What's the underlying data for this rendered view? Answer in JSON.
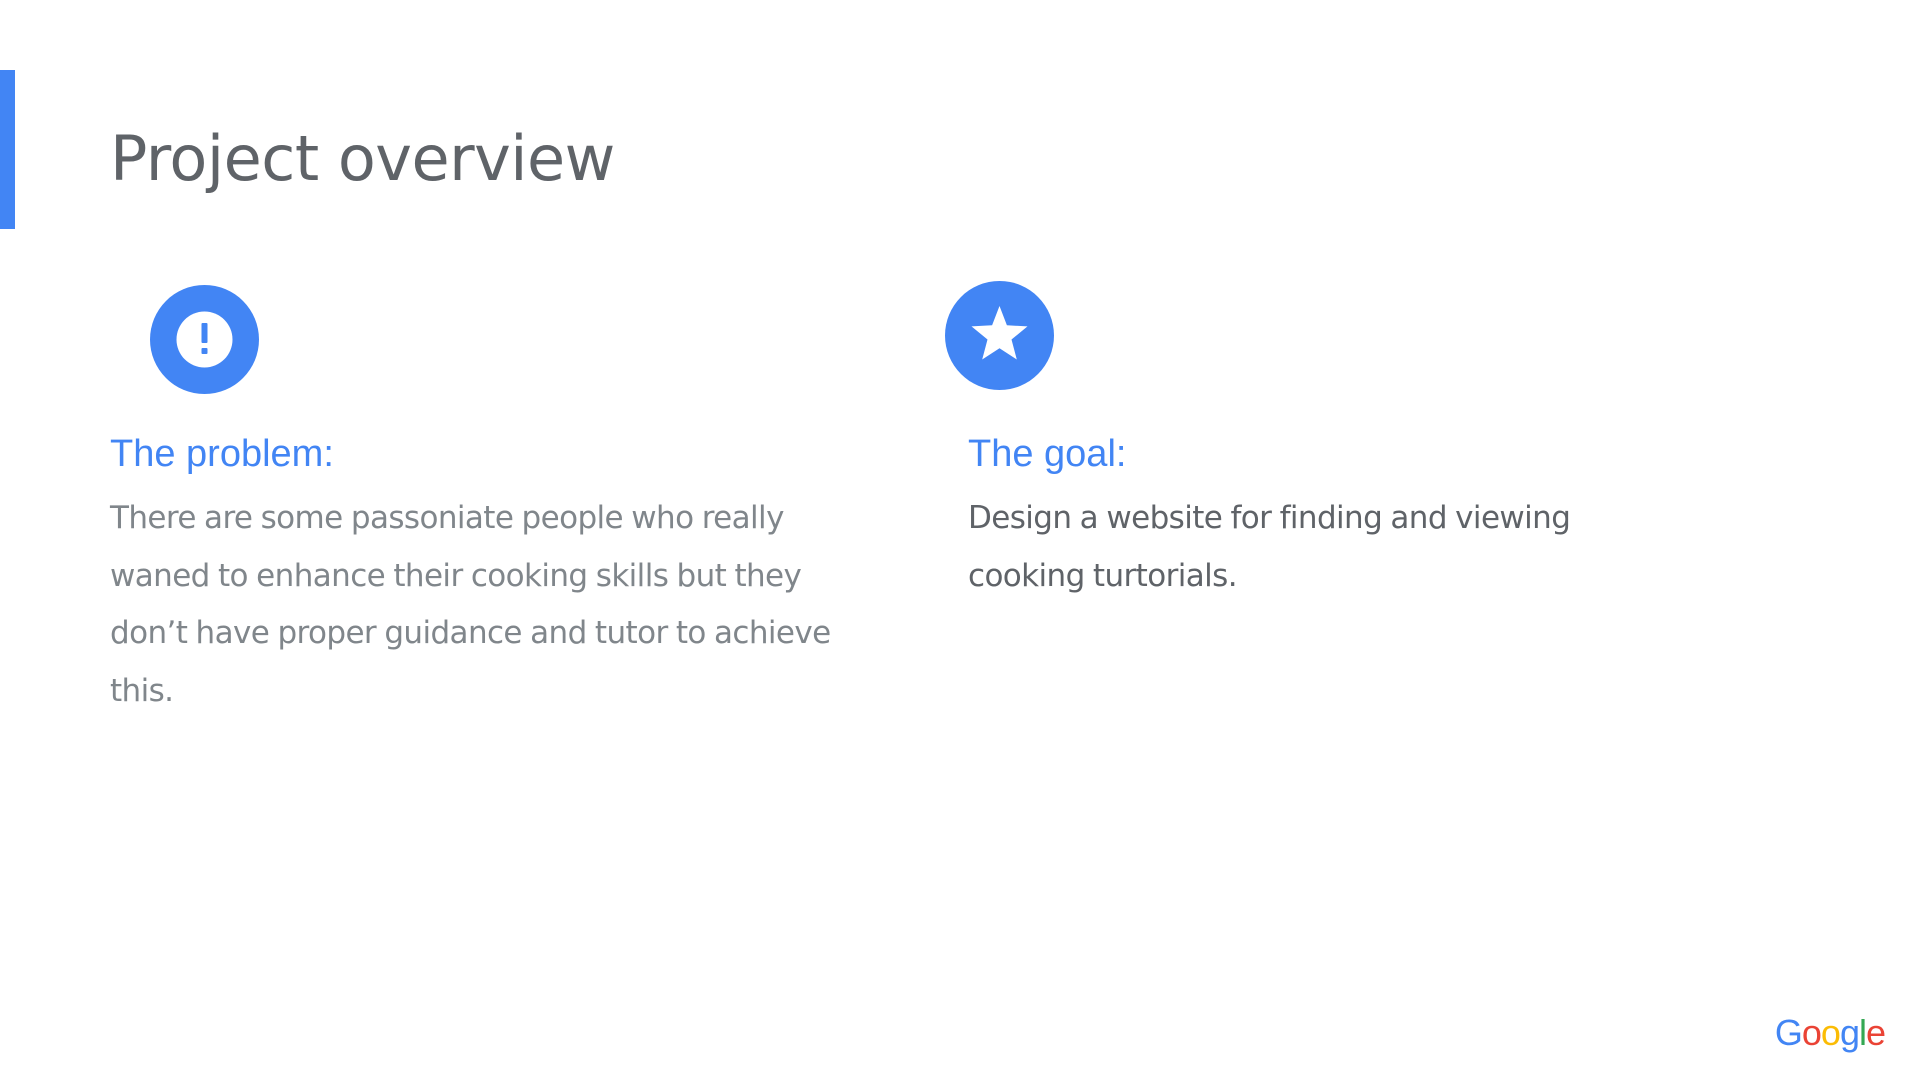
{
  "slide": {
    "title": "Project overview",
    "accent_color": "#4285f4"
  },
  "problem": {
    "icon": "exclamation-circle-icon",
    "heading": "The problem:",
    "text": "There are some passoniate people who really waned to enhance  their cooking skills but they don’t have proper guidance and tutor to achieve this."
  },
  "goal": {
    "icon": "star-circle-icon",
    "heading": "The goal:",
    "text": "Design a website for finding and viewing cooking turtorials."
  },
  "logo": {
    "text": "Google",
    "colors": [
      "#4285f4",
      "#ea4335",
      "#fbbc05",
      "#4285f4",
      "#34a853",
      "#ea4335"
    ]
  }
}
